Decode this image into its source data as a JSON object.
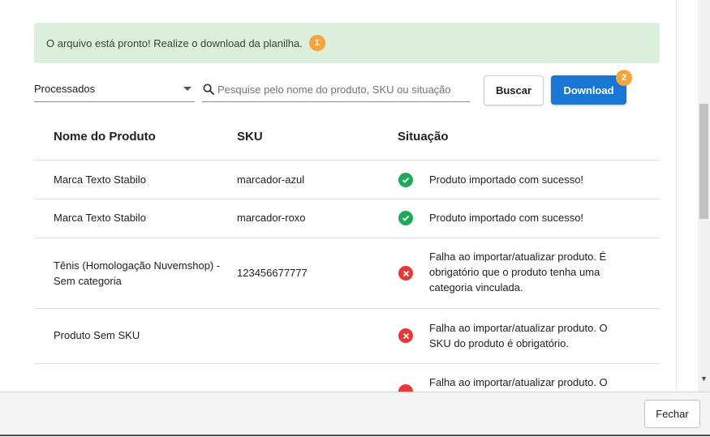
{
  "alert": {
    "message": "O arquivo está pronto! Realize o download da planilha.",
    "badge": "1"
  },
  "filter": {
    "selected": "Processados"
  },
  "search": {
    "placeholder": "Pesquise pelo nome do produto, SKU ou situação",
    "value": ""
  },
  "buttons": {
    "search_label": "Buscar",
    "download_label": "Download",
    "download_badge": "2",
    "close_label": "Fechar"
  },
  "table": {
    "headers": {
      "name": "Nome do Produto",
      "sku": "SKU",
      "status": "Situação"
    },
    "rows": [
      {
        "name": "Marca Texto Stabilo",
        "sku": "marcador-azul",
        "status_type": "success",
        "status": "Produto importado com sucesso!"
      },
      {
        "name": "Marca Texto Stabilo",
        "sku": "marcador-roxo",
        "status_type": "success",
        "status": "Produto importado com sucesso!"
      },
      {
        "name": "Tênis (Homologação Nuvemshop) - Sem categoria",
        "sku": "123456677777",
        "status_type": "error",
        "status": "Falha ao importar/atualizar produto. É obrigatório que o produto tenha uma categoria vinculada."
      },
      {
        "name": "Produto Sem SKU",
        "sku": "",
        "status_type": "error",
        "status": "Falha ao importar/atualizar produto. O SKU do produto é obrigatório."
      },
      {
        "name": "",
        "sku": "",
        "status_type": "error",
        "status": "Falha ao importar/atualizar produto. O"
      }
    ]
  },
  "colors": {
    "accent": "#1976d2",
    "badge": "#f5a33b",
    "success": "#1fa85a",
    "error": "#e53935",
    "alert_bg": "#dcefdc"
  },
  "icons": {
    "search": "search-icon",
    "success": "check-circle-icon",
    "error": "x-circle-icon",
    "dropdown": "chevron-down-icon"
  }
}
